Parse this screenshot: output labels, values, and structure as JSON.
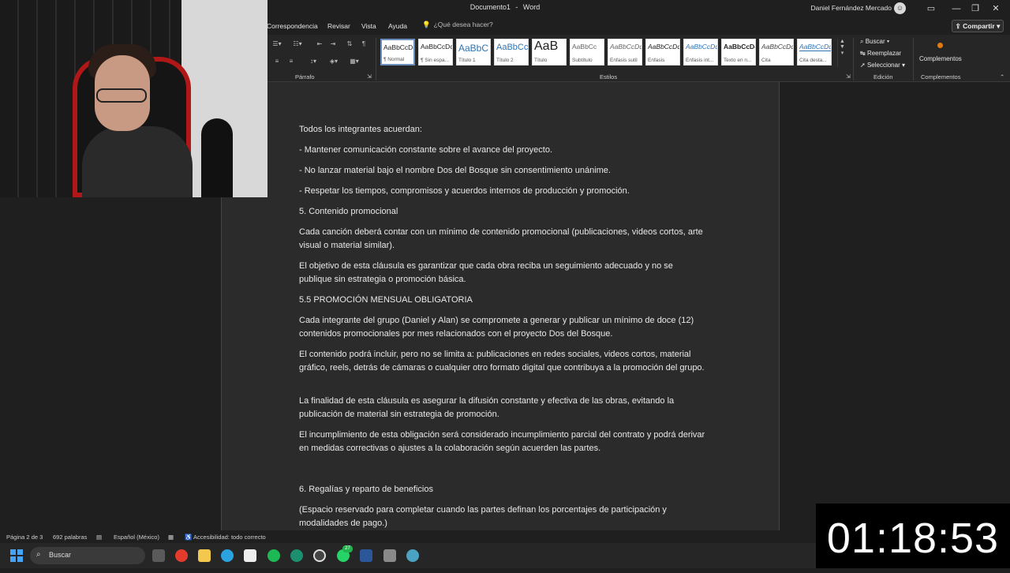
{
  "window": {
    "doc_name": "Documento1",
    "app_name": "Word",
    "separator": "-",
    "user": "Daniel Fernández Mercado",
    "minimize": "—",
    "restore": "❐",
    "close": "✕"
  },
  "menu": {
    "tabs": [
      "Correspondencia",
      "Revisar",
      "Vista",
      "Ayuda"
    ],
    "tell_me": "¿Qué desea hacer?",
    "share": "Compartir"
  },
  "ribbon": {
    "paragraph_label": "Párrafo",
    "styles_label": "Estilos",
    "editing_label": "Edición",
    "addins_label": "Complementos",
    "styles": [
      {
        "sample": "AaBbCcDc",
        "name": "¶ Normal"
      },
      {
        "sample": "AaBbCcDc",
        "name": "¶ Sin espa..."
      },
      {
        "sample": "AaBbC",
        "name": "Título 1"
      },
      {
        "sample": "AaBbCc",
        "name": "Título 2"
      },
      {
        "sample": "AaB",
        "name": "Título"
      },
      {
        "sample": "AaBbCc",
        "name": "Subtítulo"
      },
      {
        "sample": "AaBbCcDc",
        "name": "Énfasis sutil"
      },
      {
        "sample": "AaBbCcDc",
        "name": "Énfasis"
      },
      {
        "sample": "AaBbCcDc",
        "name": "Énfasis int..."
      },
      {
        "sample": "AaBbCcDc",
        "name": "Texto en n..."
      },
      {
        "sample": "AaBbCcDc",
        "name": "Cita"
      },
      {
        "sample": "AaBbCcDc",
        "name": "Cita desta..."
      }
    ],
    "edit": {
      "find": "Buscar",
      "replace": "Reemplazar",
      "select": "Seleccionar"
    },
    "addins": "Complementos"
  },
  "document": {
    "paragraphs": [
      "Todos los integrantes acuerdan:",
      "- Mantener comunicación constante sobre el avance del proyecto.",
      "- No lanzar material bajo el nombre Dos del Bosque sin consentimiento unánime.",
      "- Respetar los tiempos, compromisos y acuerdos internos de producción y promoción.",
      "5. Contenido promocional",
      "Cada canción deberá contar con un mínimo de contenido promocional (publicaciones, videos cortos, arte visual o material similar).",
      "El objetivo de esta cláusula es garantizar que cada obra reciba un seguimiento adecuado y no se publique sin estrategia o promoción básica.",
      "5.5 PROMOCIÓN MENSUAL OBLIGATORIA",
      "Cada integrante del grupo (Daniel y Alan) se compromete a generar y publicar un mínimo de doce (12) contenidos promocionales por mes relacionados con el proyecto Dos del Bosque.",
      "El contenido podrá incluir, pero no se limita a: publicaciones en redes sociales, videos cortos, material gráfico, reels, detrás de cámaras o cualquier otro formato digital que contribuya a la promoción del grupo.",
      "La finalidad de esta cláusula es asegurar la difusión constante y efectiva de las obras, evitando la publicación de material sin estrategia de promoción.",
      "El incumplimiento de esta obligación será considerado incumplimiento parcial del contrato y podrá derivar en medidas correctivas o ajustes a la colaboración según acuerden las partes.",
      "6. Regalías y reparto de beneficios",
      "(Espacio reservado para completar cuando las partes definan los porcentajes de participación y modalidades de pago.)"
    ]
  },
  "status": {
    "page": "Página 2 de 3",
    "words": "692 palabras",
    "language": "Español (México)",
    "accessibility": "Accesibilidad: todo correcto"
  },
  "taskbar": {
    "search": "Buscar",
    "badge": "27",
    "apps": [
      "task-view",
      "chrome",
      "file-explorer",
      "telegram",
      "capcut",
      "spotify",
      "edge",
      "obs",
      "whatsapp",
      "word",
      "calculator",
      "network"
    ]
  },
  "timer": "01:18:53",
  "colors": {
    "accent": "#47a3f5",
    "addins": "#e07a14",
    "background": "#1f1f1f",
    "page": "#2b2b2b"
  }
}
